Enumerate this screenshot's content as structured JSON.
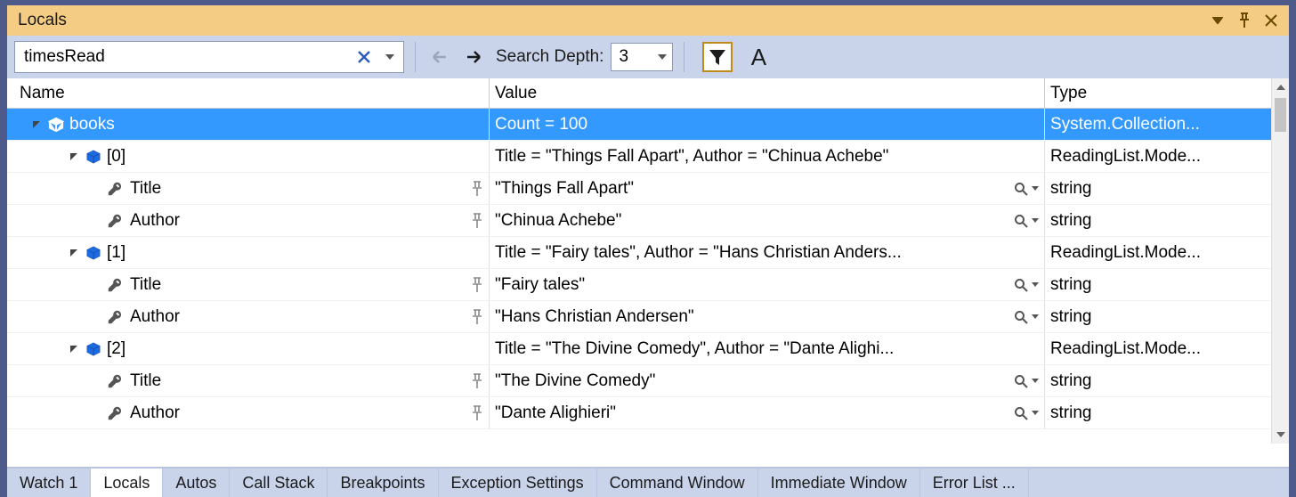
{
  "title": "Locals",
  "search": {
    "value": "timesRead"
  },
  "toolbar": {
    "depth_label": "Search Depth:",
    "depth_value": "3",
    "a_label": "A"
  },
  "columns": {
    "name": "Name",
    "value": "Value",
    "type": "Type"
  },
  "rows": [
    {
      "kind": "obj",
      "indent": 24,
      "expanded": true,
      "label": "books",
      "value": "Count = 100",
      "type": "System.Collection...",
      "selected": true
    },
    {
      "kind": "obj",
      "indent": 66,
      "expanded": true,
      "label": "[0]",
      "value": "Title = \"Things Fall Apart\", Author = \"Chinua Achebe\"",
      "type": "ReadingList.Mode...",
      "selected": false
    },
    {
      "kind": "prop",
      "indent": 108,
      "label": "Title",
      "value": "\"Things Fall Apart\"",
      "type": "string"
    },
    {
      "kind": "prop",
      "indent": 108,
      "label": "Author",
      "value": "\"Chinua Achebe\"",
      "type": "string"
    },
    {
      "kind": "obj",
      "indent": 66,
      "expanded": true,
      "label": "[1]",
      "value": "Title = \"Fairy tales\", Author = \"Hans Christian Anders...",
      "type": "ReadingList.Mode...",
      "selected": false
    },
    {
      "kind": "prop",
      "indent": 108,
      "label": "Title",
      "value": "\"Fairy tales\"",
      "type": "string"
    },
    {
      "kind": "prop",
      "indent": 108,
      "label": "Author",
      "value": "\"Hans Christian Andersen\"",
      "type": "string"
    },
    {
      "kind": "obj",
      "indent": 66,
      "expanded": true,
      "label": "[2]",
      "value": "Title = \"The Divine Comedy\", Author = \"Dante Alighi...",
      "type": "ReadingList.Mode...",
      "selected": false
    },
    {
      "kind": "prop",
      "indent": 108,
      "label": "Title",
      "value": "\"The Divine Comedy\"",
      "type": "string"
    },
    {
      "kind": "prop",
      "indent": 108,
      "label": "Author",
      "value": "\"Dante Alighieri\"",
      "type": "string"
    }
  ],
  "tabs": [
    {
      "label": "Watch 1",
      "active": false
    },
    {
      "label": "Locals",
      "active": true
    },
    {
      "label": "Autos",
      "active": false
    },
    {
      "label": "Call Stack",
      "active": false
    },
    {
      "label": "Breakpoints",
      "active": false
    },
    {
      "label": "Exception Settings",
      "active": false
    },
    {
      "label": "Command Window",
      "active": false
    },
    {
      "label": "Immediate Window",
      "active": false
    },
    {
      "label": "Error List ...",
      "active": false
    }
  ]
}
